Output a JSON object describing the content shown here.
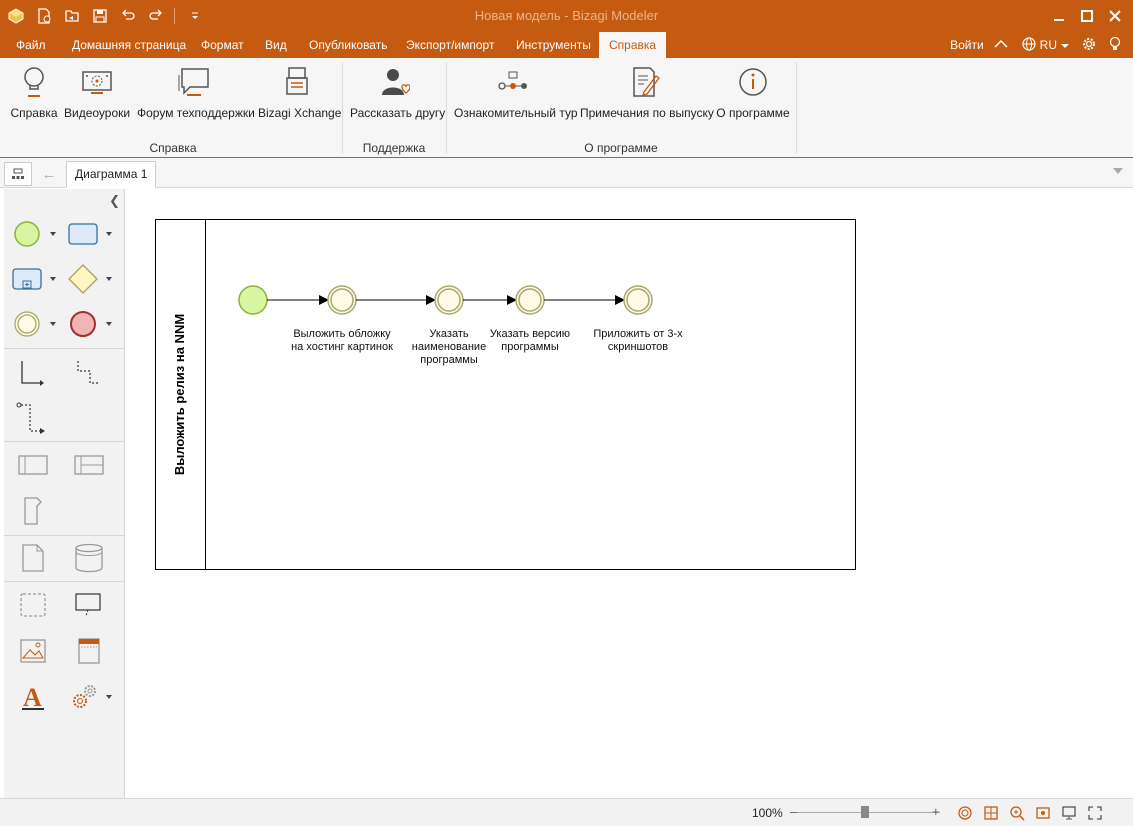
{
  "window": {
    "title": "Новая модель - Bizagi Modeler"
  },
  "quick_access": [
    "app-logo-icon",
    "new-document-icon",
    "open-icon",
    "save-icon",
    "undo-icon",
    "redo-icon",
    "customize-icon"
  ],
  "menu": {
    "items": [
      "Файл",
      "Домашняя страница",
      "Формат",
      "Вид",
      "Опубликовать",
      "Экспорт/импорт",
      "Инструменты",
      "Справка"
    ],
    "active": "Справка",
    "login": "Войти",
    "language": "RU"
  },
  "ribbon": {
    "buttons": [
      {
        "label": "Справка",
        "icon": "lightbulb-icon"
      },
      {
        "label": "Видеоуроки",
        "icon": "video-icon"
      },
      {
        "label": "Форум техподдержки",
        "icon": "forum-icon"
      },
      {
        "label": "Bizagi Xchange",
        "icon": "xchange-icon"
      },
      {
        "label": "Рассказать другу",
        "icon": "tell-friend-icon"
      },
      {
        "label": "Ознакомительный тур",
        "icon": "tour-icon"
      },
      {
        "label": "Примечания по выпуску",
        "icon": "release-notes-icon"
      },
      {
        "label": "О программе",
        "icon": "info-icon"
      }
    ],
    "groups": [
      "Справка",
      "Поддержка",
      "О программе"
    ]
  },
  "tabs": {
    "document": "Диаграмма 1"
  },
  "diagram": {
    "lane_label": "Выложить релиз на NNM",
    "tasks": [
      "Выложить обложку на хостинг картинок",
      "Указать наименование программы",
      "Указать версию программы",
      "Приложить от 3-х скриншотов"
    ],
    "colors": {
      "start": "#d8f5a2",
      "start_stroke": "#8cb33a",
      "intermediate": "#fffbe6",
      "intermediate_stroke": "#a8a870",
      "accent": "#c55a11"
    }
  },
  "status": {
    "zoom": "100%"
  }
}
